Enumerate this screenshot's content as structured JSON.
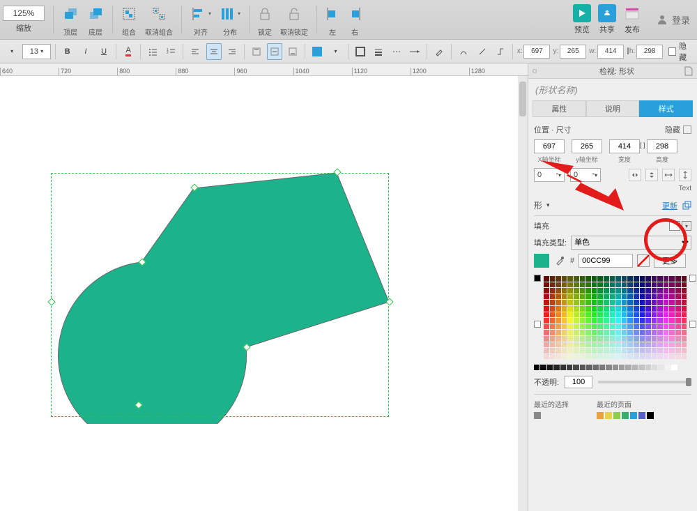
{
  "toolbar1": {
    "zoom": "125%",
    "zoom_label": "缩放",
    "layer_front": "顶层",
    "layer_back": "底层",
    "group": "组合",
    "ungroup": "取消组合",
    "align": "对齐",
    "distribute": "分布",
    "lock": "锁定",
    "unlock": "取消锁定",
    "left": "左",
    "right": "右",
    "preview": "预览",
    "share": "共享",
    "publish": "发布",
    "login": "登录"
  },
  "toolbar2": {
    "fontsize": "13",
    "pos": {
      "x_label": "x:",
      "x": "697",
      "y_label": "y:",
      "y": "265",
      "w_label": "w:",
      "w": "414",
      "h_label": "h:",
      "h": "298"
    },
    "hide": "隐藏"
  },
  "ruler_ticks": [
    "640",
    "720",
    "800",
    "880",
    "960",
    "1040",
    "1120",
    "1200",
    "1280"
  ],
  "panel": {
    "inspect_label": "检视: 形状",
    "shape_name_placeholder": "(形状名称)",
    "tabs": {
      "props": "属性",
      "notes": "说明",
      "style": "样式"
    },
    "section_possize": "位置 · 尺寸",
    "hide": "隐藏",
    "x": "697",
    "y": "265",
    "w": "414",
    "h": "298",
    "x_label": "X轴坐标",
    "y_label": "y轴坐标",
    "w_label": "宽度",
    "h_label": "高度",
    "rot1": "0",
    "rot2": "0",
    "text_label": "Text",
    "shape_toggle": "形",
    "update": "更新",
    "fill_label": "填充",
    "fill_type_label": "填充类型:",
    "fill_type_value": "单色",
    "hex_prefix": "#",
    "hex": "00CC99",
    "more": "更多",
    "opacity_label": "不透明:",
    "opacity": "100",
    "recent_sel": "最近的选择",
    "recent_page": "最近的页面"
  },
  "shape": {
    "fill": "#1bb28c"
  }
}
